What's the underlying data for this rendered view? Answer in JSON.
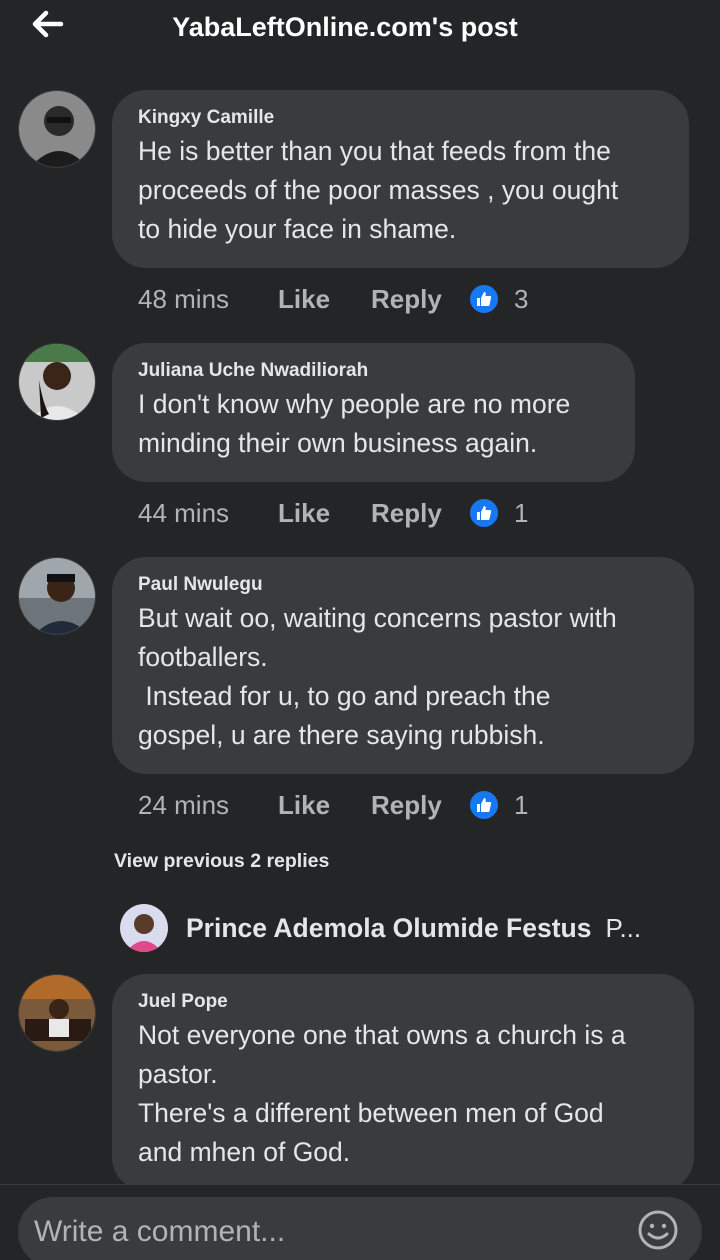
{
  "header": {
    "title": "YabaLeftOnline.com's post",
    "back_icon": "arrow-left-icon"
  },
  "comments": [
    {
      "author": "Kingxy Camille",
      "text": "He is better than you that feeds from the\nproceeds of the poor masses , you ought\nto hide your face in shame.",
      "time": "48 mins",
      "like": "Like",
      "reply": "Reply",
      "reactions": "3"
    },
    {
      "author": "Juliana Uche Nwadiliorah",
      "text": "I don't know why people are no more\nminding their own business again.",
      "time": "44 mins",
      "like": "Like",
      "reply": "Reply",
      "reactions": "1"
    },
    {
      "author": "Paul Nwulegu",
      "text": "But wait oo, waiting concerns pastor with\nfootballers.\n Instead for u, to go and preach the\ngospel, u are there saying rubbish.",
      "time": "24 mins",
      "like": "Like",
      "reply": "Reply",
      "reactions": "1"
    },
    {
      "author": "Juel Pope",
      "text": "Not everyone one that owns a church is a\npastor.\nThere's a different between men of God\nand mhen of God."
    }
  ],
  "view_previous_replies": "View previous 2 replies",
  "reply_preview": {
    "author": "Prince Ademola Olumide Festus",
    "snippet": "P..."
  },
  "composer": {
    "placeholder": "Write a comment...",
    "emoji_icon": "smiley-icon"
  },
  "colors": {
    "background": "#242526",
    "bubble": "#3a3b3c",
    "text": "#e4e6eb",
    "muted": "#b0b3b8",
    "like_blue": "#1877f2"
  }
}
